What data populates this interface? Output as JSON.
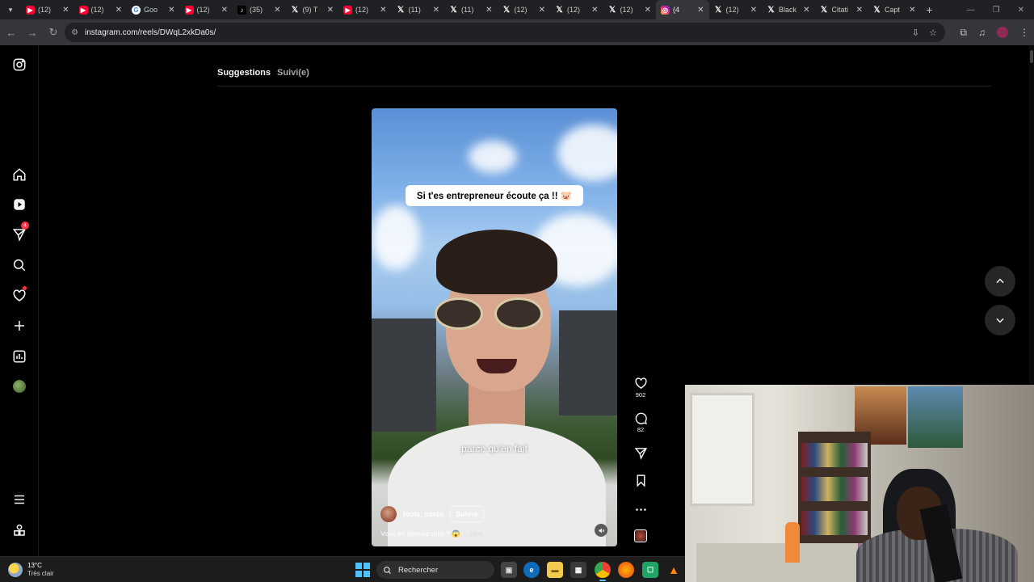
{
  "browser": {
    "tabs": [
      {
        "icon": "youtube-icon",
        "title": "(12)",
        "kind": "yt"
      },
      {
        "icon": "youtube-icon",
        "title": "(12)",
        "kind": "yt"
      },
      {
        "icon": "google-icon",
        "title": "Goo",
        "kind": "g"
      },
      {
        "icon": "youtube-icon",
        "title": "(12)",
        "kind": "yt"
      },
      {
        "icon": "tiktok-icon",
        "title": "(35)",
        "kind": "tt"
      },
      {
        "icon": "x-icon",
        "title": "(9) T",
        "kind": "xx"
      },
      {
        "icon": "youtube-icon",
        "title": "(12)",
        "kind": "yt"
      },
      {
        "icon": "x-icon",
        "title": "(11)",
        "kind": "xx"
      },
      {
        "icon": "x-icon",
        "title": "(11)",
        "kind": "xx"
      },
      {
        "icon": "x-icon",
        "title": "(12)",
        "kind": "xx"
      },
      {
        "icon": "x-icon",
        "title": "(12)",
        "kind": "xx"
      },
      {
        "icon": "x-icon",
        "title": "(12)",
        "kind": "xx"
      },
      {
        "icon": "instagram-icon",
        "title": "(4",
        "kind": "ig",
        "active": true
      },
      {
        "icon": "x-icon",
        "title": "(12)",
        "kind": "xx"
      },
      {
        "icon": "x-icon",
        "title": "Black",
        "kind": "xx"
      },
      {
        "icon": "x-icon",
        "title": "Citati",
        "kind": "xx"
      },
      {
        "icon": "x-icon",
        "title": "Capt",
        "kind": "xx"
      }
    ],
    "url": "instagram.com/reels/DWqL2xkDa0s/"
  },
  "instagram": {
    "feed_tabs": {
      "suggestions": "Suggestions",
      "following": "Suivi(e)"
    },
    "notification_count": "4",
    "reel": {
      "overlay_caption": "Si t'es entrepreneur écoute ça !! 🐷",
      "subtitle": "parce qu'en fait",
      "author": "louis_nasto",
      "follow_label": "Suivre",
      "description": "Vous en pensez quoi ? 😱",
      "more_label": "... plus"
    },
    "actions": {
      "likes": "902",
      "comments": "82"
    }
  },
  "taskbar": {
    "temperature": "13°C",
    "condition": "Très clair",
    "search_label": "Rechercher"
  },
  "colors": {
    "instagram_notification": "#ff3040",
    "windows_accent": "#4cc2ff",
    "browser_frame": "#202124"
  }
}
